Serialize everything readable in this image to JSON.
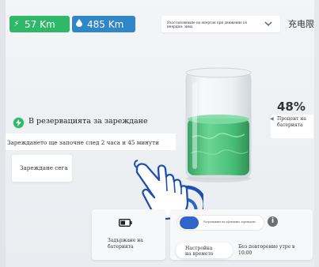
{
  "status": {
    "range_green": "57 Km",
    "range_blue": "485 Km",
    "mode_select_value": "Възстановяване на енергия при движение по инерция: зима",
    "language_tab": "充电限"
  },
  "icons": {
    "range_green": "lightning-icon",
    "range_blue": "water-drop-icon",
    "dropdown": "chevron-down-icon",
    "reservation": "charging-clock-icon",
    "keep_battery": "battery-icon",
    "info": "info-icon",
    "touch": "pointing-hand-icon"
  },
  "battery": {
    "percent": "48%",
    "percent_value": 48,
    "percent_label": "Процент на батерията"
  },
  "reservation": {
    "title": "В резервацията за зареждане",
    "schedule_text": "Зареждането ще започне след 2 часа и 45 минути",
    "charge_now_button": "Зареждане сега"
  },
  "cards": {
    "keep_battery_label": "Задържане на батерията",
    "toggle_label": "Разрешаване на ефективно зареждане",
    "time_setting_button": "Настройка на времето",
    "repeat_text": "Без повторение утре в 10:00"
  },
  "colors": {
    "green_chip": "#2fb86a",
    "blue_chip": "#2f87c8",
    "toggle_on": "#2f64c8",
    "liquid": "#34b86a"
  }
}
